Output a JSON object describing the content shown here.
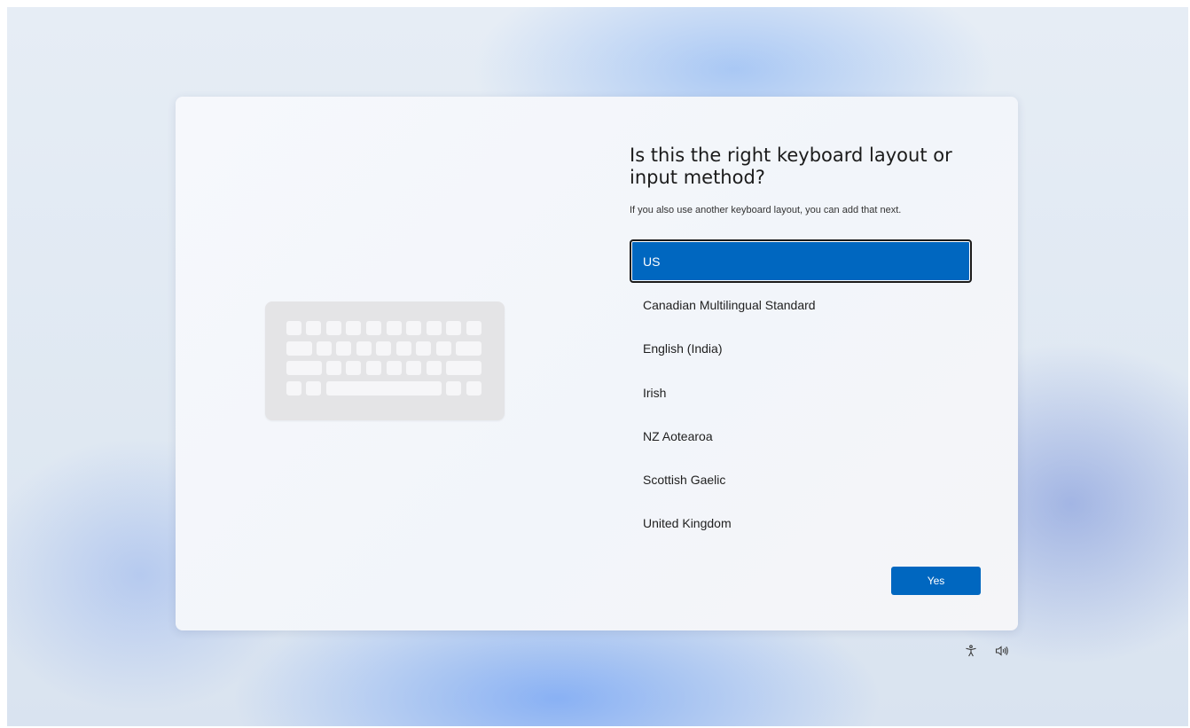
{
  "dialog": {
    "title": "Is this the right keyboard layout or input method?",
    "subtitle": "If you also use another keyboard layout, you can add that next.",
    "layouts": [
      "US",
      "Canadian Multilingual Standard",
      "English (India)",
      "Irish",
      "NZ Aotearoa",
      "Scottish Gaelic",
      "United Kingdom"
    ],
    "selected_layout": "US",
    "yes_label": "Yes"
  },
  "illustration": {
    "icon": "keyboard-illustration"
  },
  "tray": {
    "icons": [
      "accessibility-icon",
      "volume-icon"
    ]
  },
  "colors": {
    "accent": "#0067c0",
    "card_background": "#f4f6fa",
    "keyboard_body": "#e4e4e6"
  }
}
